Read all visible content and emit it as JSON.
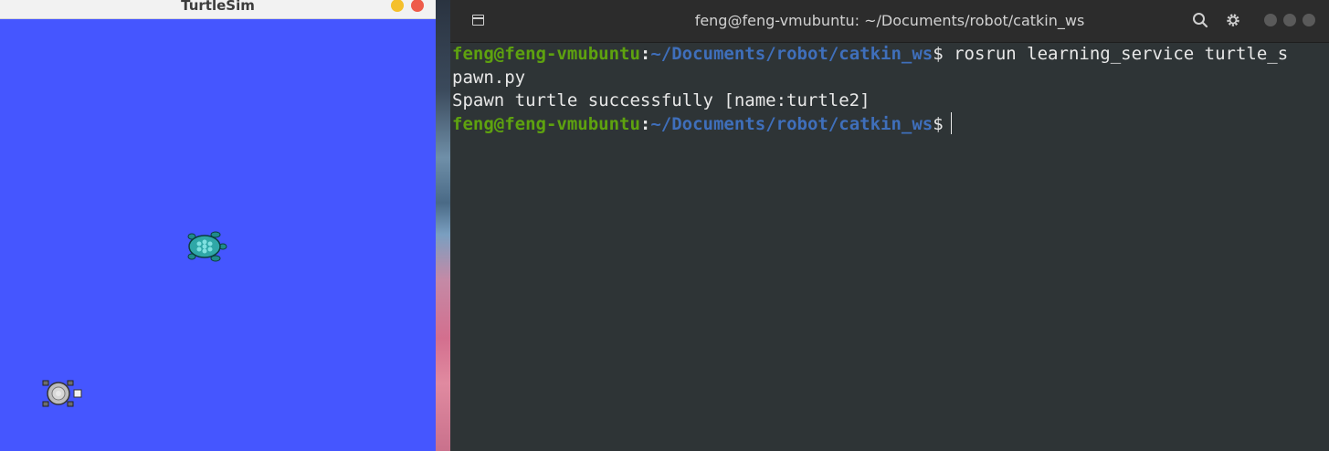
{
  "turtlesim": {
    "title": "TurtleSim",
    "background_color": "#4556ff",
    "turtles": [
      {
        "name": "turtle-teal",
        "color": "#2fa7a7"
      },
      {
        "name": "turtle-gray",
        "color": "#bdbdbd"
      }
    ]
  },
  "terminal": {
    "title": "feng@feng-vmubuntu: ~/Documents/robot/catkin_ws",
    "icons": [
      "new-tab-icon",
      "search-icon",
      "gear-icon"
    ],
    "lines": [
      {
        "user": "feng@feng-vmubuntu",
        "colon": ":",
        "path": "~/Documents/robot/catkin_ws",
        "dollar": "$",
        "command": " rosrun learning_service turtle_s"
      },
      {
        "text": "pawn.py"
      },
      {
        "text": "Spawn turtle successfully [name:turtle2]"
      },
      {
        "user": "feng@feng-vmubuntu",
        "colon": ":",
        "path": "~/Documents/robot/catkin_ws",
        "dollar": "$",
        "command": ""
      }
    ],
    "colors": {
      "user": "#5ea20f",
      "path": "#3f6fbb",
      "background": "#2e3436"
    }
  }
}
